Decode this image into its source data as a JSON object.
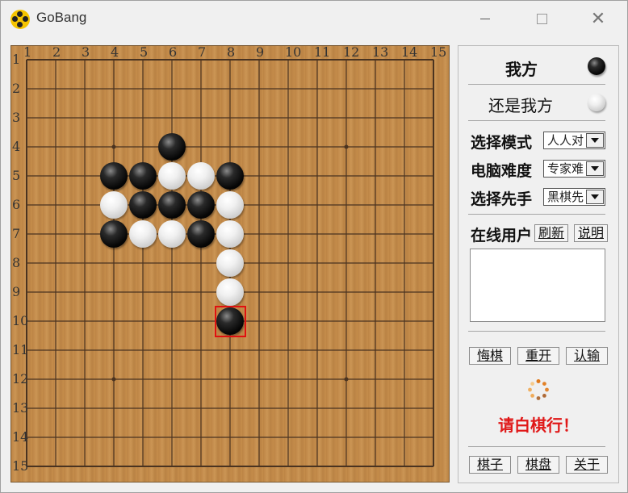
{
  "window": {
    "title": "GoBang",
    "app_icon": "gobang-app-icon",
    "controls": [
      "minimize-icon",
      "maximize-icon",
      "close-icon"
    ]
  },
  "board": {
    "size": 15,
    "columns": [
      "1",
      "2",
      "3",
      "4",
      "5",
      "6",
      "7",
      "8",
      "9",
      "10",
      "11",
      "12",
      "13",
      "14",
      "15"
    ],
    "rows": [
      "1",
      "2",
      "3",
      "4",
      "5",
      "6",
      "7",
      "8",
      "9",
      "10",
      "11",
      "12",
      "13",
      "14",
      "15"
    ],
    "star_points": [
      [
        4,
        4
      ],
      [
        12,
        4
      ],
      [
        4,
        12
      ],
      [
        12,
        12
      ]
    ],
    "stones": [
      {
        "col": 6,
        "row": 4,
        "color": "black"
      },
      {
        "col": 4,
        "row": 5,
        "color": "black"
      },
      {
        "col": 5,
        "row": 5,
        "color": "black"
      },
      {
        "col": 6,
        "row": 5,
        "color": "white"
      },
      {
        "col": 7,
        "row": 5,
        "color": "white"
      },
      {
        "col": 8,
        "row": 5,
        "color": "black"
      },
      {
        "col": 4,
        "row": 6,
        "color": "white"
      },
      {
        "col": 5,
        "row": 6,
        "color": "black"
      },
      {
        "col": 6,
        "row": 6,
        "color": "black"
      },
      {
        "col": 7,
        "row": 6,
        "color": "black"
      },
      {
        "col": 8,
        "row": 6,
        "color": "white"
      },
      {
        "col": 4,
        "row": 7,
        "color": "black"
      },
      {
        "col": 5,
        "row": 7,
        "color": "white"
      },
      {
        "col": 6,
        "row": 7,
        "color": "white"
      },
      {
        "col": 7,
        "row": 7,
        "color": "black"
      },
      {
        "col": 8,
        "row": 7,
        "color": "white"
      },
      {
        "col": 8,
        "row": 8,
        "color": "white"
      },
      {
        "col": 8,
        "row": 9,
        "color": "white"
      },
      {
        "col": 8,
        "row": 10,
        "color": "black"
      }
    ],
    "last_move": {
      "col": 8,
      "row": 10
    },
    "colors": {
      "wood": "#c58d4c",
      "line": "#4a3320",
      "marker": "#e01010"
    }
  },
  "panel": {
    "player1": {
      "label": "我方",
      "stone": "black"
    },
    "player2": {
      "label": "还是我方",
      "stone": "white"
    },
    "mode": {
      "label": "选择模式",
      "value": "人人对"
    },
    "difficulty": {
      "label": "电脑难度",
      "value": "专家难"
    },
    "first": {
      "label": "选择先手",
      "value": "黑棋先"
    },
    "online": {
      "label": "在线用户",
      "refresh": "刷新",
      "help": "说明"
    },
    "actions": {
      "undo": "悔棋",
      "restart": "重开",
      "resign": "认输"
    },
    "status": "请白棋行！",
    "bottom": {
      "pieces": "棋子",
      "board": "棋盘",
      "about": "关于"
    },
    "colors": {
      "status": "#e01818",
      "spinner": "#e07a1c"
    }
  }
}
